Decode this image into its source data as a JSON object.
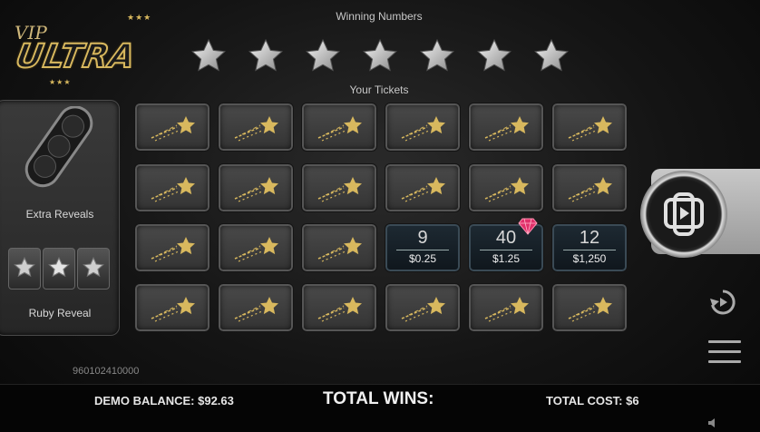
{
  "logo": {
    "vip": "VIP",
    "ultra": "ULTRA"
  },
  "labels": {
    "winning_numbers": "Winning Numbers",
    "your_tickets": "Your Tickets"
  },
  "winning_numbers": [
    "star",
    "star",
    "star",
    "star",
    "star",
    "star",
    "star"
  ],
  "left_panel": {
    "extra_reveals": "Extra Reveals",
    "ruby_reveal": "Ruby Reveal"
  },
  "tickets": [
    [
      {
        "state": "hidden"
      },
      {
        "state": "hidden"
      },
      {
        "state": "hidden"
      },
      {
        "state": "hidden"
      },
      {
        "state": "hidden"
      },
      {
        "state": "hidden"
      }
    ],
    [
      {
        "state": "hidden"
      },
      {
        "state": "hidden"
      },
      {
        "state": "hidden"
      },
      {
        "state": "hidden"
      },
      {
        "state": "hidden"
      },
      {
        "state": "hidden"
      }
    ],
    [
      {
        "state": "hidden"
      },
      {
        "state": "hidden"
      },
      {
        "state": "hidden"
      },
      {
        "state": "revealed",
        "number": "9",
        "prize": "$0.25"
      },
      {
        "state": "revealed",
        "number": "40",
        "prize": "$1.25",
        "ruby": true
      },
      {
        "state": "revealed",
        "number": "12",
        "prize": "$1,250"
      }
    ],
    [
      {
        "state": "hidden"
      },
      {
        "state": "hidden"
      },
      {
        "state": "hidden"
      },
      {
        "state": "hidden"
      },
      {
        "state": "hidden"
      },
      {
        "state": "hidden"
      }
    ]
  ],
  "ticket_id": "960102410000",
  "footer": {
    "balance": "DEMO BALANCE: $92.63",
    "total_wins": "TOTAL WINS:",
    "total_cost": "TOTAL COST: $6"
  },
  "colors": {
    "gold": "#d8b85e",
    "ruby": "#e0306a",
    "tile": "#3c3c3c"
  }
}
